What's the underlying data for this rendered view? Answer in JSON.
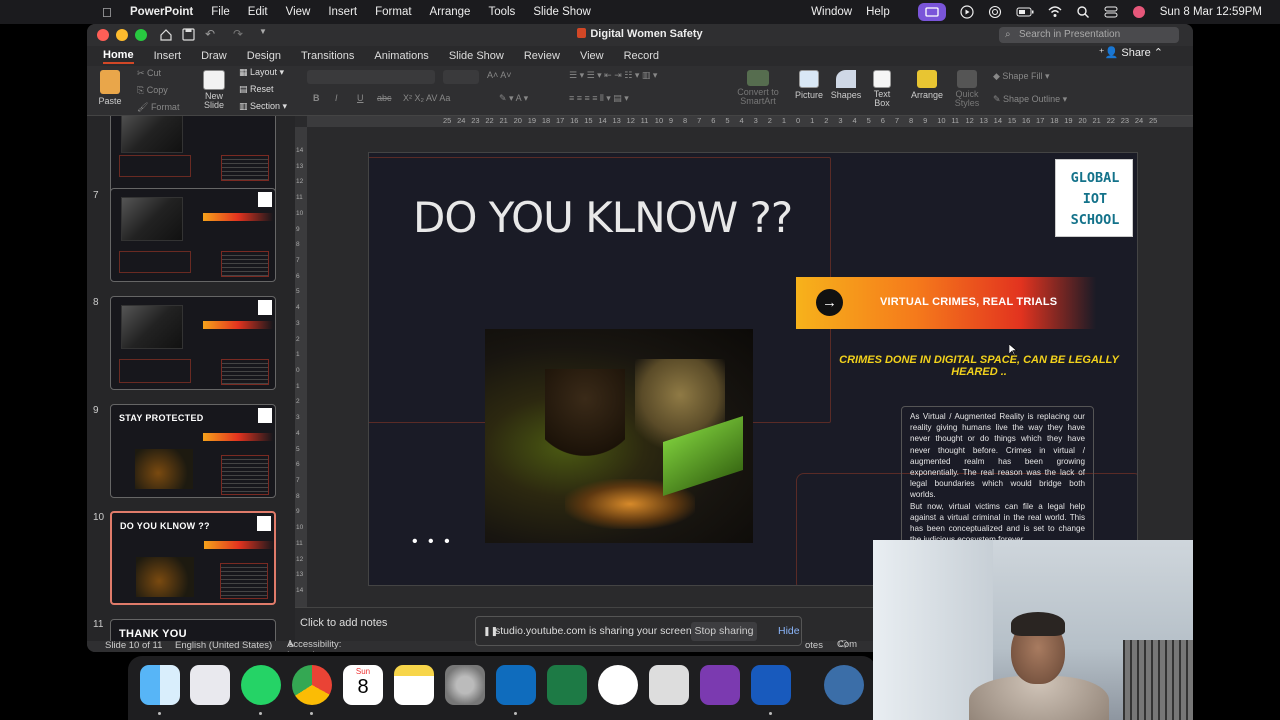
{
  "menubar": {
    "app": "PowerPoint",
    "items": [
      "File",
      "Edit",
      "View",
      "Insert",
      "Format",
      "Arrange",
      "Tools",
      "Slide Show"
    ],
    "right_items": [
      "Window",
      "Help"
    ],
    "clock": "Sun 8 Mar  12:59PM"
  },
  "window": {
    "title": "Digital Women Safety",
    "search_placeholder": "Search in Presentation",
    "share_label": "Share",
    "tabs": [
      "Home",
      "Insert",
      "Draw",
      "Design",
      "Transitions",
      "Animations",
      "Slide Show",
      "Review",
      "View",
      "Record"
    ],
    "active_tab": "Home"
  },
  "ribbon": {
    "paste": "Paste",
    "cut": "Cut",
    "copy": "Copy",
    "format": "Format",
    "new_slide": "New Slide",
    "layout": "Layout",
    "reset": "Reset",
    "section": "Section",
    "convert_smartart": "Convert to SmartArt",
    "picture": "Picture",
    "shapes": "Shapes",
    "text_box": "Text Box",
    "arrange": "Arrange",
    "quick_styles": "Quick Styles",
    "shape_fill": "Shape Fill",
    "shape_outline": "Shape Outline"
  },
  "thumbnails": [
    {
      "num": "7",
      "title": ""
    },
    {
      "num": "8",
      "title": ""
    },
    {
      "num": "9",
      "title": "STAY PROTECTED"
    },
    {
      "num": "10",
      "title": "DO YOU KLNOW ??"
    },
    {
      "num": "11",
      "title": "THANK YOU"
    }
  ],
  "ruler_h": [
    "25",
    "24",
    "23",
    "22",
    "21",
    "20",
    "19",
    "18",
    "17",
    "16",
    "15",
    "14",
    "13",
    "12",
    "11",
    "10",
    "9",
    "8",
    "7",
    "6",
    "5",
    "4",
    "3",
    "2",
    "1",
    "0",
    "1",
    "2",
    "3",
    "4",
    "5",
    "6",
    "7",
    "8",
    "9",
    "10",
    "11",
    "12",
    "13",
    "14",
    "15",
    "16",
    "17",
    "18",
    "19",
    "20",
    "21",
    "22",
    "23",
    "24",
    "25"
  ],
  "ruler_v": [
    "14",
    "13",
    "12",
    "11",
    "10",
    "9",
    "8",
    "7",
    "6",
    "5",
    "4",
    "3",
    "2",
    "1",
    "0",
    "1",
    "2",
    "3",
    "4",
    "5",
    "6",
    "7",
    "8",
    "9",
    "10",
    "11",
    "12",
    "13",
    "14"
  ],
  "slide": {
    "title": "DO YOU KLNOW ??",
    "logo_lines": [
      "GLOBAL",
      "IOT",
      "SCHOOL"
    ],
    "banner_text": "VIRTUAL CRIMES, REAL TRIALS",
    "subline": "CRIMES DONE IN DIGITAL SPACE, CAN BE LEGALLY HEARED ..",
    "body_p1": "As Virtual / Augmented Reality is replacing our reality giving humans live the way they have never thought or do things which they have never thought before. Crimes in virtual / augmented realm has been growing exponentially. The real reason was the lack of legal boundaries which would bridge both worlds.",
    "body_p2": "But now, virtual victims can file a legal help against a virtual criminal in the real world. This has been conceptualized and is set to change the judicious ecosystem forever.",
    "dots": "• • •"
  },
  "notes_placeholder": "Click to add notes",
  "status": {
    "slide_info": "Slide 10 of 11",
    "language": "English (United States)",
    "accessibility": "Accessibility: Investigate",
    "notes": "otes",
    "comments": "Com"
  },
  "sharebar": {
    "message": "studio.youtube.com is sharing your screen.",
    "stop": "Stop sharing",
    "hide": "Hide"
  },
  "dock": {
    "calendar_month": "Sun",
    "calendar_day": "8",
    "apps": [
      "finder-icon",
      "launchpad-icon",
      "whatsapp-icon",
      "chrome-icon",
      "calendar-icon",
      "notes-icon",
      "settings-icon",
      "outlook-icon",
      "excel-icon",
      "chatgpt-icon",
      "screenshot-icon",
      "onenote-icon",
      "word-icon",
      "unknown-app-icon"
    ]
  }
}
